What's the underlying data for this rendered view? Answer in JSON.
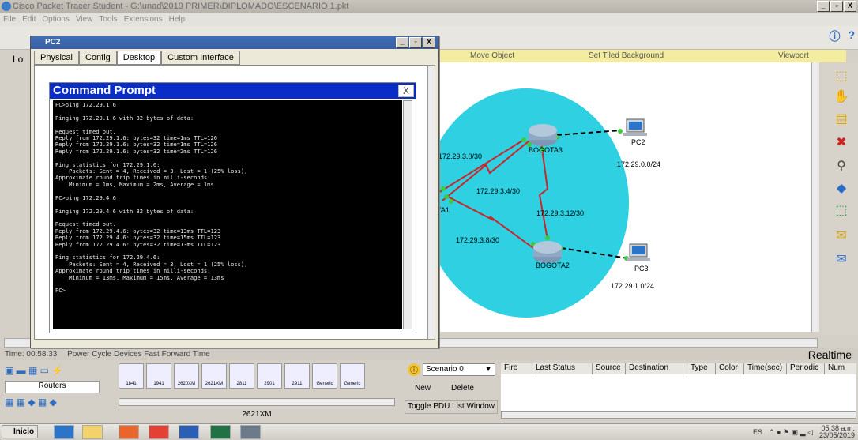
{
  "app": {
    "title": "Cisco Packet Tracer Student - G:\\unad\\2019 PRIMER\\DIPLOMADO\\ESCENARIO 1.pkt",
    "menu": [
      "File",
      "Edit",
      "Options",
      "View",
      "Tools",
      "Extensions",
      "Help"
    ],
    "window_controls": [
      "_",
      "&#x25A1;",
      "X"
    ]
  },
  "workspace": {
    "bar_items": [
      "Move Object",
      "Set Tiled Background",
      "Viewport"
    ],
    "time_label": "Time: 00:58:33",
    "time_links": "Power Cycle Devices   Fast Forward Time",
    "realtime": "Realtime"
  },
  "pc2_window": {
    "title": "PC2",
    "tabs": [
      "Physical",
      "Config",
      "Desktop",
      "Custom Interface"
    ],
    "active_tab": "Desktop"
  },
  "command_prompt": {
    "title": "Command Prompt",
    "close": "X",
    "lines": [
      "PC>ping 172.29.1.6",
      "",
      "Pinging 172.29.1.6 with 32 bytes of data:",
      "",
      "Request timed out.",
      "Reply from 172.29.1.6: bytes=32 time=1ms TTL=126",
      "Reply from 172.29.1.6: bytes=32 time=1ms TTL=126",
      "Reply from 172.29.1.6: bytes=32 time=2ms TTL=126",
      "",
      "Ping statistics for 172.29.1.6:",
      "    Packets: Sent = 4, Received = 3, Lost = 1 (25% loss),",
      "Approximate round trip times in milli-seconds:",
      "    Minimum = 1ms, Maximum = 2ms, Average = 1ms",
      "",
      "PC>ping 172.29.4.6",
      "",
      "Pinging 172.29.4.6 with 32 bytes of data:",
      "",
      "Request timed out.",
      "Reply from 172.29.4.6: bytes=32 time=13ms TTL=123",
      "Reply from 172.29.4.6: bytes=32 time=15ms TTL=123",
      "Reply from 172.29.4.6: bytes=32 time=13ms TTL=123",
      "",
      "Ping statistics for 172.29.4.6:",
      "    Packets: Sent = 4, Received = 3, Lost = 1 (25% loss),",
      "Approximate round trip times in milli-seconds:",
      "    Minimum = 13ms, Maximum = 15ms, Average = 13ms",
      "",
      "PC>"
    ]
  },
  "topology": {
    "devices": {
      "bogota3": "BOGOTA3",
      "bogota2": "BOGOTA2",
      "bogota1_partial": "TA1",
      "pc2": "PC2",
      "pc3": "PC3"
    },
    "networks": {
      "n1": "172.29.3.0/30",
      "n2": "172.29.3.4/30",
      "n3": "172.29.3.8/30",
      "n4": "172.29.3.12/30",
      "lan2": "172.29.0.0/24",
      "lan3": "172.29.1.0/24"
    },
    "left_partial": [
      "Lo",
      "172",
      "1"
    ]
  },
  "device_panel": {
    "category": "Routers",
    "models": [
      "1841",
      "1941",
      "2620XM",
      "2621XM",
      "2811",
      "2901",
      "2911",
      "Generic",
      "Generic"
    ],
    "selected_model": "2621XM"
  },
  "pdu": {
    "scenario": "Scenario 0",
    "new": "New",
    "delete": "Delete",
    "toggle": "Toggle PDU List Window",
    "columns": [
      "Fire",
      "Last Status",
      "Source",
      "Destination",
      "Type",
      "Color",
      "Time(sec)",
      "Periodic",
      "Num"
    ]
  },
  "taskbar": {
    "start": "Inicio",
    "lang": "ES",
    "time": "05:38 a.m.",
    "date": "23/05/2019"
  },
  "colors": {
    "cloud": "#2ed0e2",
    "link": "#c8262a",
    "titlebar": "#0a2dc8"
  }
}
